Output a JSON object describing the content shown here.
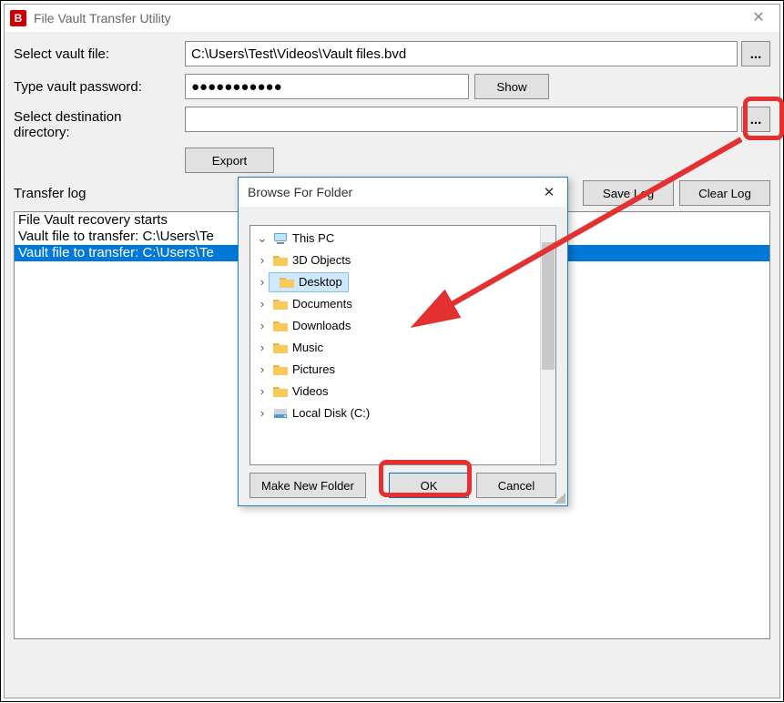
{
  "window": {
    "title": "File Vault Transfer Utility",
    "app_icon_letter": "B"
  },
  "labels": {
    "select_vault_file": "Select vault file:",
    "type_password": "Type vault password:",
    "select_dest_line1": "Select destination",
    "select_dest_line2": "directory:",
    "transfer_log": "Transfer log"
  },
  "inputs": {
    "vault_file_value": "C:\\Users\\Test\\Videos\\Vault files.bvd",
    "password_value": "●●●●●●●●●●●",
    "dest_value": ""
  },
  "buttons": {
    "browse": "...",
    "show": "Show",
    "export": "Export",
    "save_log": "Save Log",
    "clear_log": "Clear Log"
  },
  "log_lines": [
    {
      "t": "File Vault recovery starts",
      "sel": false
    },
    {
      "t": "Vault file to transfer: C:\\Users\\Te",
      "sel": false
    },
    {
      "t": "Vault file to transfer: C:\\Users\\Te",
      "sel": true
    }
  ],
  "dialog": {
    "title": "Browse For Folder",
    "root": "This PC",
    "items": [
      "3D Objects",
      "Desktop",
      "Documents",
      "Downloads",
      "Music",
      "Pictures",
      "Videos",
      "Local Disk (C:)"
    ],
    "selected_index": 1,
    "buttons": {
      "make_new": "Make New Folder",
      "ok": "OK",
      "cancel": "Cancel"
    }
  }
}
